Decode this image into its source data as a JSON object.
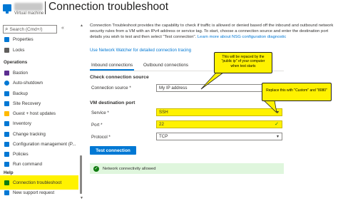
{
  "header": {
    "title": "Connection troubleshoot",
    "subtitle": "Virtual machine"
  },
  "sidebar": {
    "search_placeholder": "Search (Cmd+/)",
    "collapse_label": "«",
    "items": [
      {
        "label": "Properties",
        "icon": "properties-icon",
        "color": "#0078d4"
      },
      {
        "label": "Locks",
        "icon": "lock-icon",
        "color": "#605e5c"
      },
      {
        "label": "Operations",
        "type": "group"
      },
      {
        "label": "Bastion",
        "icon": "bastion-icon",
        "color": "#5c2d91"
      },
      {
        "label": "Auto-shutdown",
        "icon": "clock-icon",
        "color": "#0078d4"
      },
      {
        "label": "Backup",
        "icon": "backup-icon",
        "color": "#0078d4"
      },
      {
        "label": "Site Recovery",
        "icon": "site-recovery-icon",
        "color": "#0078d4"
      },
      {
        "label": "Guest + host updates",
        "icon": "updates-icon",
        "color": "#ffb900"
      },
      {
        "label": "Inventory",
        "icon": "inventory-icon",
        "color": "#0078d4"
      },
      {
        "label": "Change tracking",
        "icon": "change-tracking-icon",
        "color": "#0078d4"
      },
      {
        "label": "Configuration management (P...",
        "icon": "configuration-icon",
        "color": "#0078d4"
      },
      {
        "label": "Policies",
        "icon": "policies-icon",
        "color": "#0078d4"
      },
      {
        "label": "Run command",
        "icon": "run-command-icon",
        "color": "#0078d4"
      },
      {
        "label": "Help",
        "type": "group"
      },
      {
        "label": "Connection troubleshoot",
        "icon": "connection-troubleshoot-icon",
        "color": "#107c10",
        "selected": true
      },
      {
        "label": "New support request",
        "icon": "support-icon",
        "color": "#0078d4"
      }
    ]
  },
  "main": {
    "description_text": "Connection Troubleshoot provides the capability to check if traffic is allowed or denied based off the inbound and outbound network security rules from a VM with an IPv4 address or service tag. To start, choose a connection source and enter the destination port details you wish to test and then select \"Test connection\".",
    "description_link": "Learn more about NSG configuration diagnostic",
    "network_watcher_link": "Use Network Watcher for detailed connection tracing",
    "tabs": [
      {
        "label": "Inbound connections",
        "active": true
      },
      {
        "label": "Outbound connections",
        "active": false
      }
    ],
    "check_source_heading": "Check connection source",
    "connection_source_label": "Connection source *",
    "connection_source_value": "My IP address",
    "vm_dest_heading": "VM destination port",
    "service_label": "Service *",
    "service_value": "SSH",
    "port_label": "Port *",
    "port_value": "22",
    "protocol_label": "Protocol *",
    "protocol_value": "TCP",
    "test_button": "Test connection",
    "result_text": "Network connectivity allowed"
  },
  "annotations": {
    "callout1": "This will be repaced by the \"public ip\" of your computer when test starts",
    "callout2": "Replace this with \"Custom\" and \"8080\"",
    "highlight_color": "#fff200"
  }
}
